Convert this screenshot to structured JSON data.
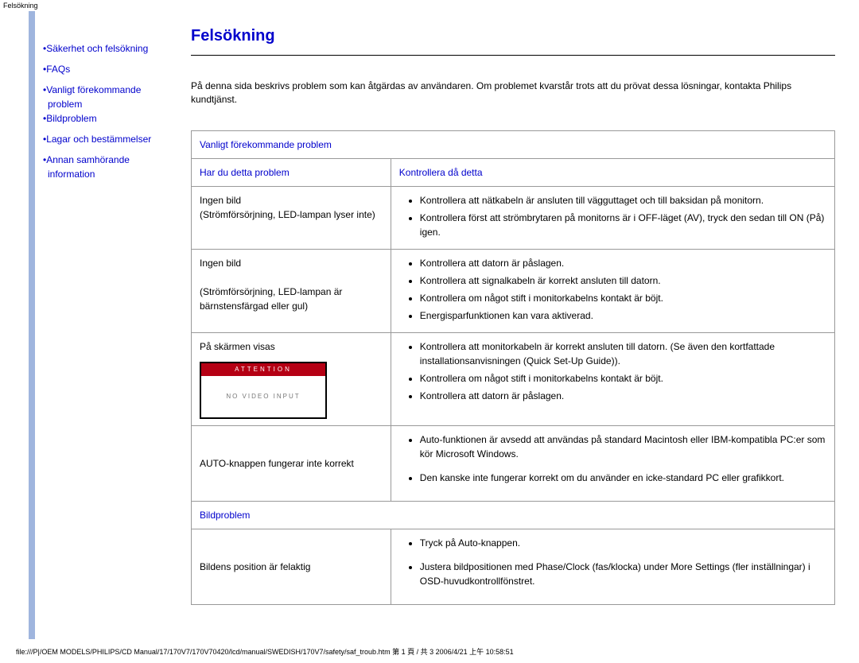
{
  "page_label": "Felsökning",
  "sidebar": {
    "items": [
      {
        "label": "Säkerhet och felsökning"
      },
      {
        "label": "FAQs"
      },
      {
        "label": "Vanligt förekommande problem",
        "wrap": true
      },
      {
        "label": "Bildproblem"
      },
      {
        "label": "Lagar och bestämmelser"
      },
      {
        "label": "Annan samhörande information",
        "wrap": true
      }
    ]
  },
  "main": {
    "title": "Felsökning",
    "intro": "På denna sida beskrivs problem som kan åtgärdas av användaren. Om problemet kvarstår trots att du prövat dessa lösningar, kontakta Philips kundtjänst.",
    "section1": {
      "header": "Vanligt förekommande problem",
      "col1": "Har du detta problem",
      "col2": "Kontrollera då detta",
      "rows": [
        {
          "problem_line1": "Ingen bild",
          "problem_line2": "(Strömförsörjning, LED-lampan lyser inte)",
          "checks": [
            "Kontrollera att nätkabeln är ansluten till vägguttaget och till baksidan på monitorn.",
            "Kontrollera först att strömbrytaren på monitorns är i OFF-läget (AV), tryck den sedan till ON (På) igen."
          ]
        },
        {
          "problem_line1": "Ingen bild",
          "problem_line2": "(Strömförsörjning, LED-lampan är bärnstensfärgad eller gul)",
          "checks": [
            "Kontrollera att datorn är påslagen.",
            "Kontrollera att signalkabeln är korrekt ansluten till datorn.",
            "Kontrollera om något stift i monitorkabelns kontakt är böjt.",
            "Energisparfunktionen kan vara aktiverad."
          ]
        },
        {
          "problem_line1": "På skärmen visas",
          "attention_top": "ATTENTION",
          "attention_body": "NO VIDEO INPUT",
          "checks": [
            "Kontrollera att monitorkabeln är korrekt ansluten till datorn. (Se även den kortfattade installationsanvisningen (Quick Set-Up Guide)).",
            "Kontrollera om något stift i monitorkabelns kontakt är böjt.",
            "Kontrollera att datorn är påslagen."
          ]
        },
        {
          "problem_line1": "AUTO-knappen fungerar inte korrekt",
          "checks": [
            "Auto-funktionen är avsedd att användas på standard Macintosh eller IBM-kompatibla PC:er som kör Microsoft Windows.",
            "Den kanske inte fungerar korrekt om du använder en icke-standard PC eller grafikkort."
          ],
          "loose": true
        }
      ]
    },
    "section2": {
      "header": "Bildproblem",
      "rows": [
        {
          "problem_line1": "Bildens position är felaktig",
          "checks": [
            "Tryck på Auto-knappen.",
            "Justera bildpositionen med Phase/Clock (fas/klocka) under More Settings (fler inställningar) i OSD-huvudkontrollfönstret."
          ],
          "loose": true
        }
      ]
    }
  },
  "footer": "file:///P|/OEM MODELS/PHILIPS/CD Manual/17/170V7/170V70420/lcd/manual/SWEDISH/170V7/safety/saf_troub.htm 第 1 頁 / 共 3 2006/4/21 上午 10:58:51"
}
